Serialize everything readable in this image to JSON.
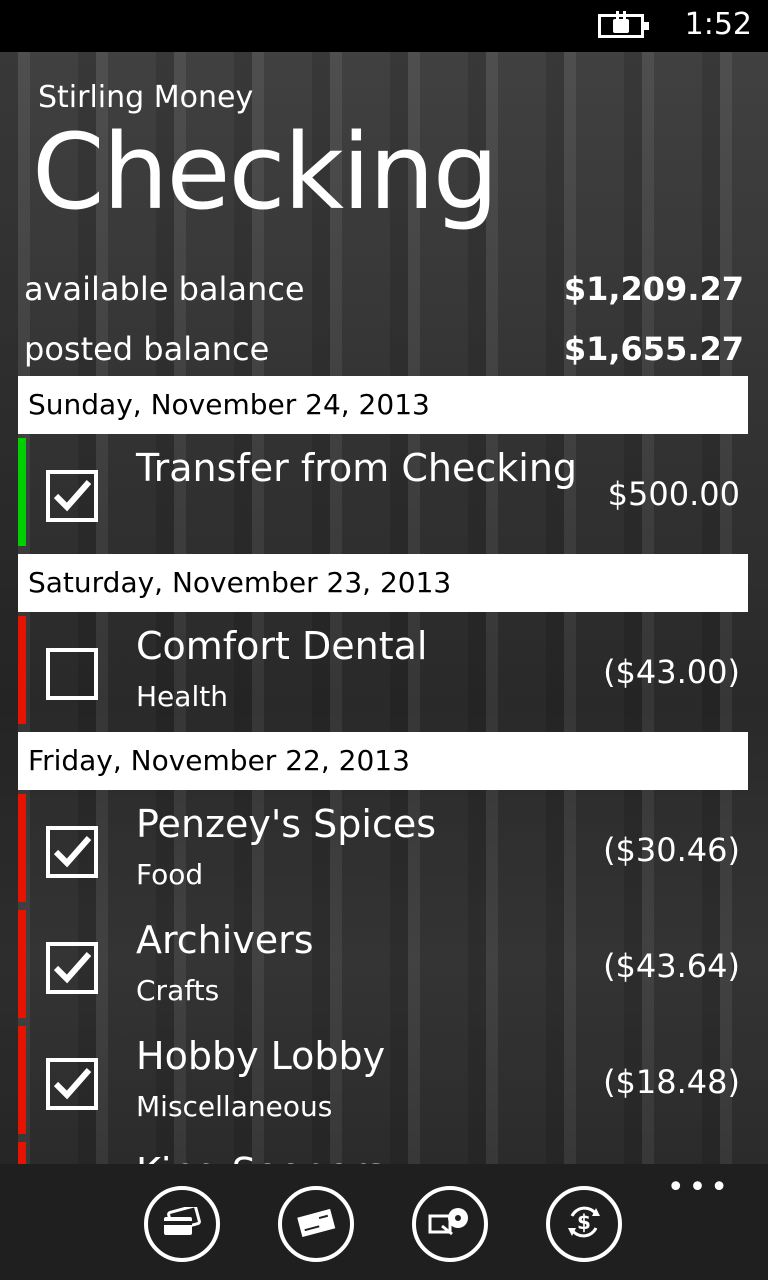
{
  "status": {
    "time": "1:52"
  },
  "app": {
    "name": "Stirling Money",
    "page_title": "Checking"
  },
  "balances": {
    "available_label": "available balance",
    "available_value": "$1,209.27",
    "posted_label": "posted balance",
    "posted_value": "$1,655.27"
  },
  "groups": [
    {
      "date": "Sunday, November 24, 2013",
      "transactions": [
        {
          "name": "Transfer from Checking",
          "category": "",
          "amount": "$500.00",
          "checked": true,
          "color": "#00d000"
        }
      ]
    },
    {
      "date": "Saturday, November 23, 2013",
      "transactions": [
        {
          "name": "Comfort Dental",
          "category": "Health",
          "amount": "($43.00)",
          "checked": false,
          "color": "#e51400"
        }
      ]
    },
    {
      "date": "Friday, November 22, 2013",
      "transactions": [
        {
          "name": "Penzey's Spices",
          "category": "Food",
          "amount": "($30.46)",
          "checked": true,
          "color": "#e51400"
        },
        {
          "name": "Archivers",
          "category": "Crafts",
          "amount": "($43.64)",
          "checked": true,
          "color": "#e51400"
        },
        {
          "name": "Hobby Lobby",
          "category": "Miscellaneous",
          "amount": "($18.48)",
          "checked": true,
          "color": "#e51400"
        },
        {
          "name": "King Soopers",
          "category": "",
          "amount": "",
          "checked": true,
          "color": "#e51400"
        }
      ]
    }
  ],
  "app_bar": {
    "buttons": [
      {
        "icon": "credit-card-icon"
      },
      {
        "icon": "check-document-icon"
      },
      {
        "icon": "tag-icon"
      },
      {
        "icon": "transfer-dollar-icon"
      }
    ],
    "more": "•••"
  },
  "colors": {
    "income": "#00d000",
    "expense": "#e51400",
    "header_bg": "#ffffff"
  }
}
